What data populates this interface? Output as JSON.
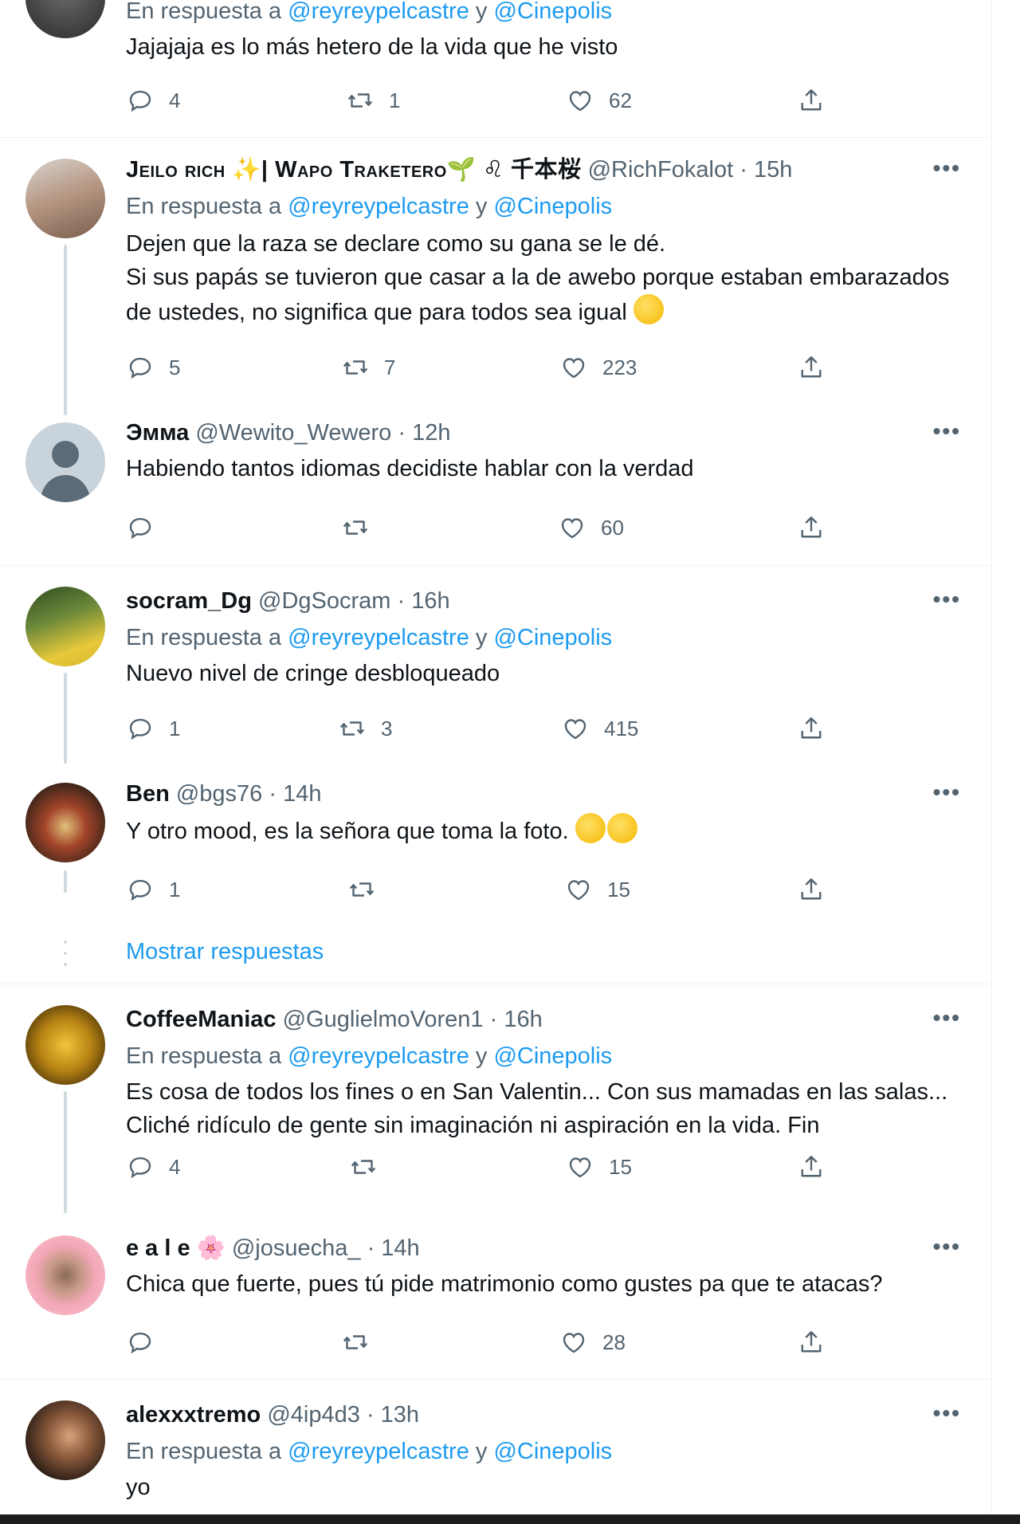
{
  "reply_prefix": "En respuesta a",
  "reply_joiner": "y",
  "tweets": [
    {
      "reply_to": [
        "@reyreypelcastre",
        "@Cinepolis"
      ],
      "text": "Jajajaja es lo más hetero de la vida que he visto",
      "replies": "4",
      "retweets": "1",
      "likes": "62"
    },
    {
      "name": "Jeilo rich ✨| Wapo Traketero🌱 ♌ 千本桜",
      "handle": "@RichFokalot",
      "time": "15h",
      "reply_to": [
        "@reyreypelcastre",
        "@Cinepolis"
      ],
      "text": "Dejen que la raza se declare como su gana se le dé.\nSi sus papás se tuvieron que casar a la de awebo porque estaban embarazados de ustedes, no significa que para todos sea igual",
      "emoji": "😴",
      "replies": "5",
      "retweets": "7",
      "likes": "223"
    },
    {
      "name": "Эмма",
      "handle": "@Wewito_Wewero",
      "time": "12h",
      "text": "Habiendo tantos idiomas decidiste hablar con la verdad",
      "replies": "",
      "retweets": "",
      "likes": "60"
    },
    {
      "name": "socram_Dg",
      "handle": "@DgSocram",
      "time": "16h",
      "reply_to": [
        "@reyreypelcastre",
        "@Cinepolis"
      ],
      "text": "Nuevo nivel de cringe desbloqueado",
      "replies": "1",
      "retweets": "3",
      "likes": "415"
    },
    {
      "name": "Ben",
      "handle": "@bgs76",
      "time": "14h",
      "text": "Y otro mood, es la señora que toma la foto.",
      "emoji": "😱😱",
      "replies": "1",
      "retweets": "",
      "likes": "15"
    },
    {
      "name": "CoffeeManiac",
      "handle": "@GuglielmoVoren1",
      "time": "16h",
      "reply_to": [
        "@reyreypelcastre",
        "@Cinepolis"
      ],
      "text": "Es cosa de todos los fines o en San Valentin... Con sus mamadas en las salas... Cliché ridículo de gente sin imaginación ni aspiración en la vida. Fin",
      "replies": "4",
      "retweets": "",
      "likes": "15"
    },
    {
      "name": "e a l e 🌸",
      "handle": "@josuecha_",
      "time": "14h",
      "text": "Chica que fuerte, pues tú pide matrimonio como gustes pa que te atacas?",
      "replies": "",
      "retweets": "",
      "likes": "28"
    },
    {
      "name": "alexxxtremo",
      "handle": "@4ip4d3",
      "time": "13h",
      "reply_to": [
        "@reyreypelcastre",
        "@Cinepolis"
      ],
      "text": "yo"
    }
  ],
  "show_replies_label": "Mostrar respuestas",
  "more_glyph": "•••",
  "colors": {
    "accent": "#1d9bf0",
    "secondary": "#536471",
    "line": "#cfd9de",
    "border": "#eff3f4"
  }
}
